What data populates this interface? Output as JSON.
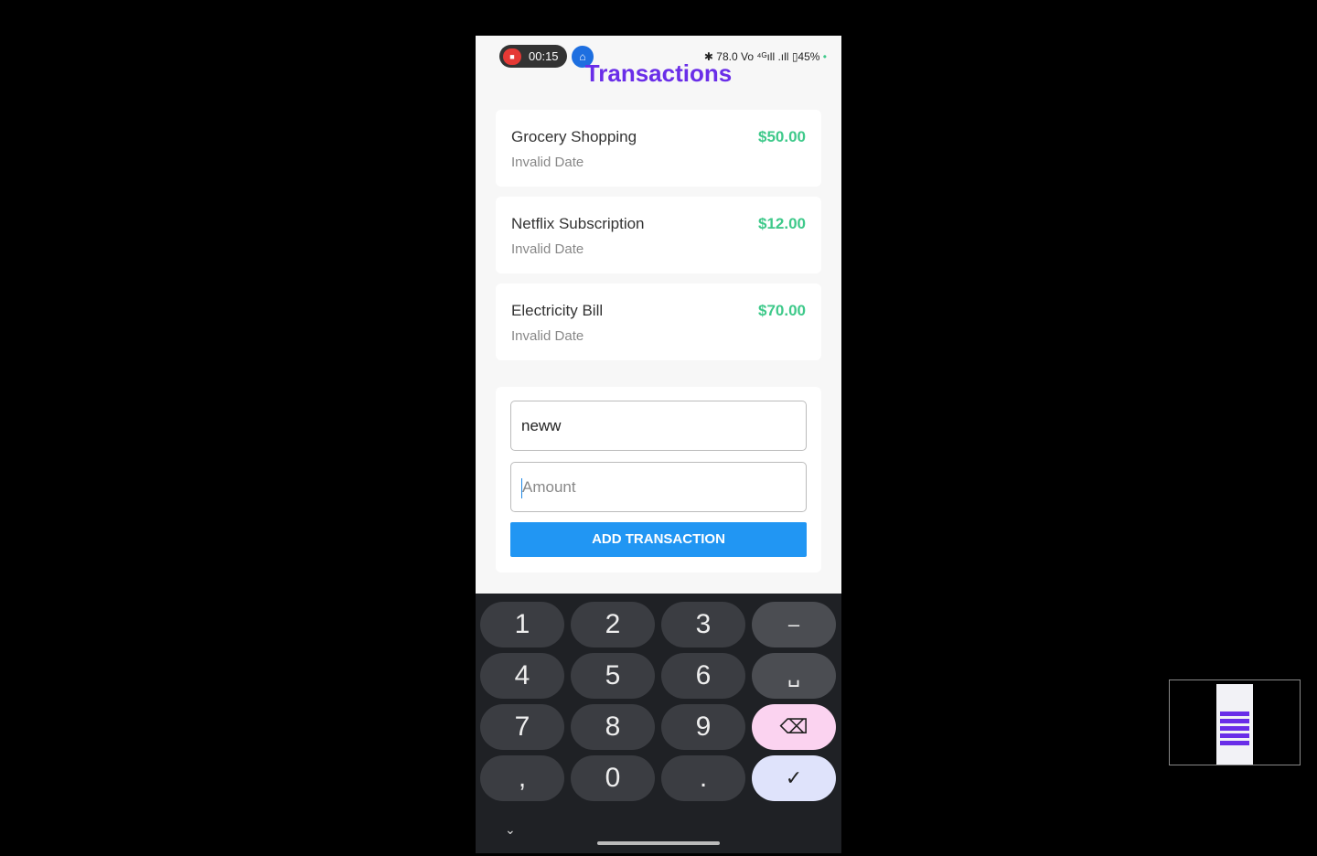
{
  "status_bar": {
    "recording_time": "00:15",
    "system_icons": "✱ 78.0 Vo ⁴ᴳıll .ıll",
    "battery": "45%"
  },
  "header": {
    "title": "Transactions"
  },
  "transactions": [
    {
      "name": "Grocery Shopping",
      "date": "Invalid Date",
      "amount": "$50.00"
    },
    {
      "name": "Netflix Subscription",
      "date": "Invalid Date",
      "amount": "$12.00"
    },
    {
      "name": "Electricity Bill",
      "date": "Invalid Date",
      "amount": "$70.00"
    }
  ],
  "form": {
    "name_value": "neww",
    "amount_placeholder": "Amount",
    "submit_label": "ADD TRANSACTION"
  },
  "keyboard": {
    "keys": [
      "1",
      "2",
      "3",
      "–",
      "4",
      "5",
      "6",
      "␣",
      "7",
      "8",
      "9",
      "⌫",
      ",",
      "0",
      ".",
      "✓"
    ],
    "collapse": "⌄"
  },
  "colors": {
    "accent": "#6a2ee8",
    "amount": "#3ec98a",
    "button": "#2196f3"
  }
}
